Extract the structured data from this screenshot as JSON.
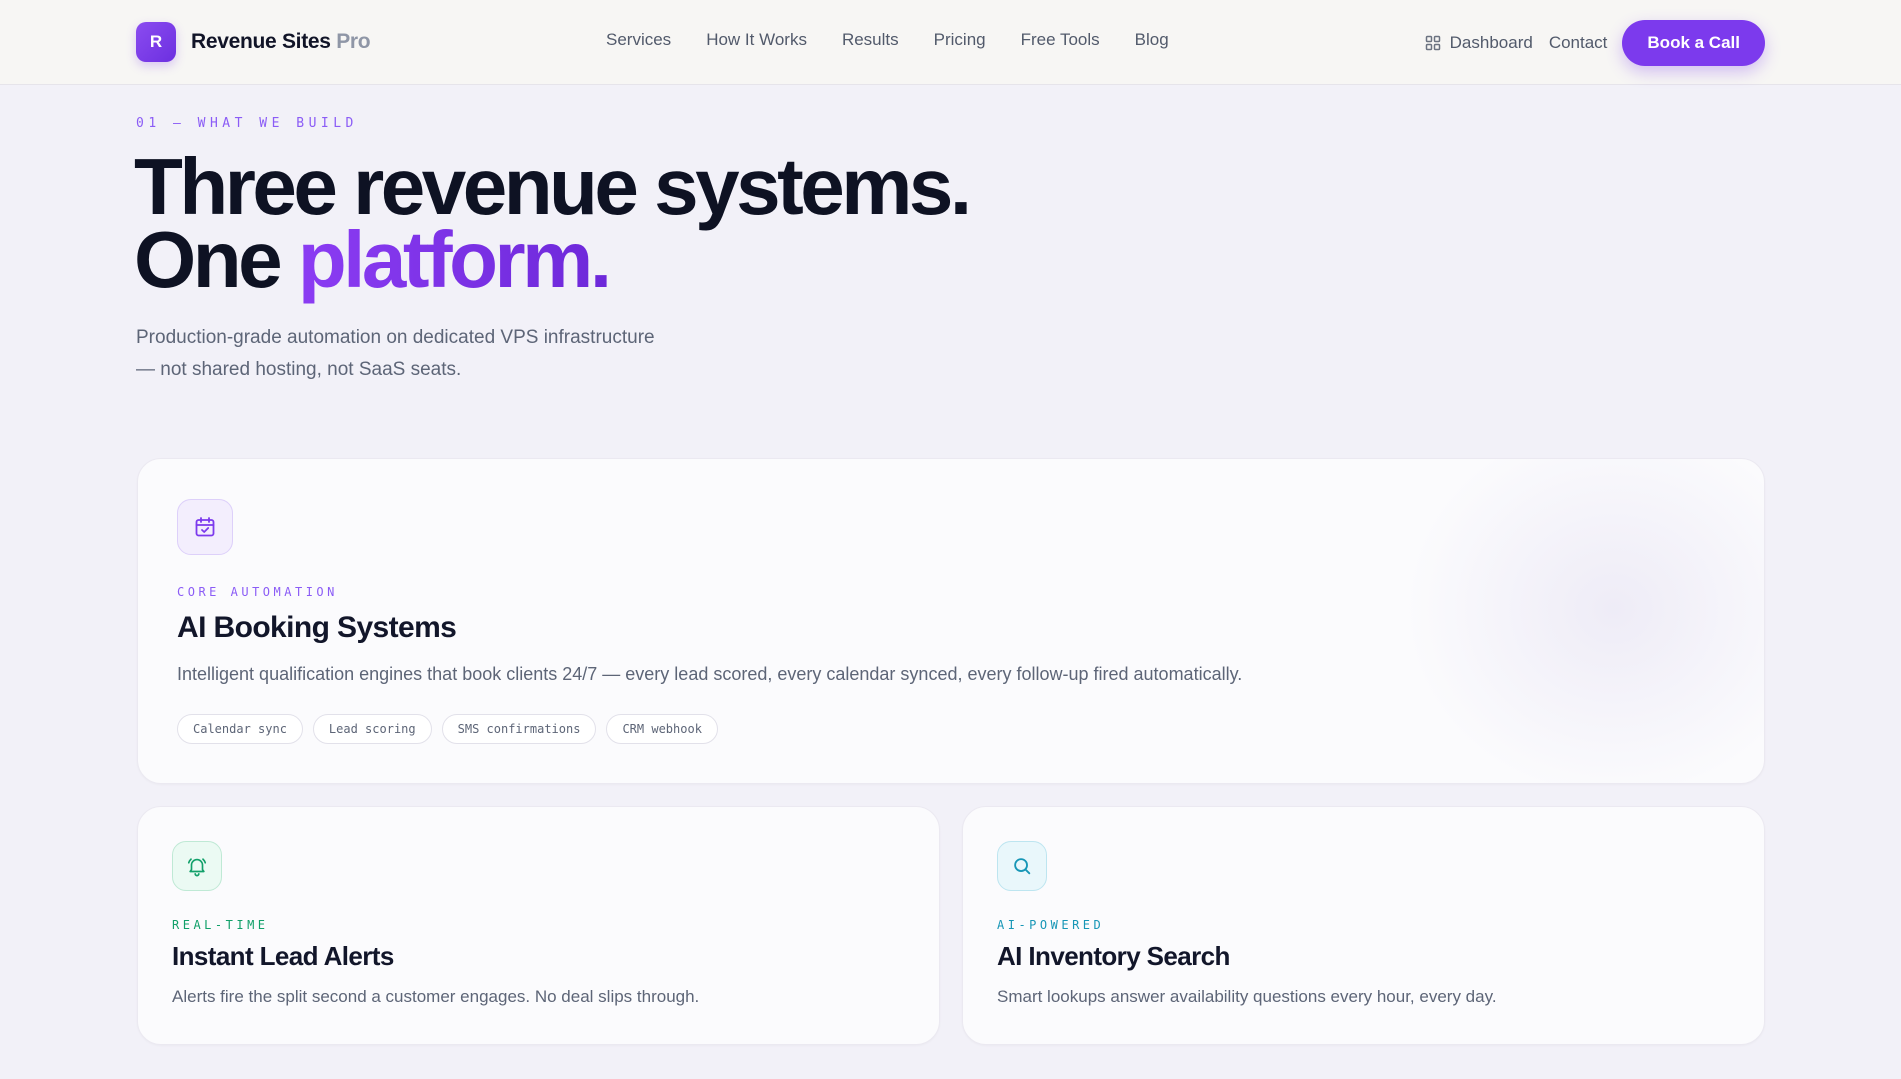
{
  "nav": {
    "logo_letter": "R",
    "brand_name": "Revenue Sites",
    "brand_suffix": "Pro",
    "links": [
      "Services",
      "How It Works",
      "Results",
      "Pricing",
      "Free Tools",
      "Blog"
    ],
    "dashboard_label": "Dashboard",
    "contact_label": "Contact",
    "cta_label": "Book a Call"
  },
  "hero": {
    "eyebrow": "01 — WHAT WE BUILD",
    "headline_line1": "Three revenue systems.",
    "headline_line2_prefix": "One ",
    "headline_line2_accent": "platform.",
    "subtitle": "Production-grade automation on dedicated VPS infrastructure — not shared hosting, not SaaS seats."
  },
  "cards": {
    "booking": {
      "icon": "calendar-check-icon",
      "tag": "CORE AUTOMATION",
      "title": "AI Booking Systems",
      "description": "Intelligent qualification engines that book clients 24/7 — every lead scored, every calendar synced, every follow-up fired automatically.",
      "chips": [
        "Calendar sync",
        "Lead scoring",
        "SMS confirmations",
        "CRM webhook"
      ]
    },
    "alerts": {
      "icon": "bell-ring-icon",
      "tag": "REAL-TIME",
      "title": "Instant Lead Alerts",
      "description": "Alerts fire the split second a customer engages. No deal slips through."
    },
    "search": {
      "icon": "search-icon",
      "tag": "AI-POWERED",
      "title": "AI Inventory Search",
      "description": "Smart lookups answer availability questions every hour, every day."
    }
  },
  "colors": {
    "brand": "#7c3aed",
    "green_accent": "#12a06a",
    "cyan_accent": "#1796b6",
    "background": "#f2f1f8"
  }
}
